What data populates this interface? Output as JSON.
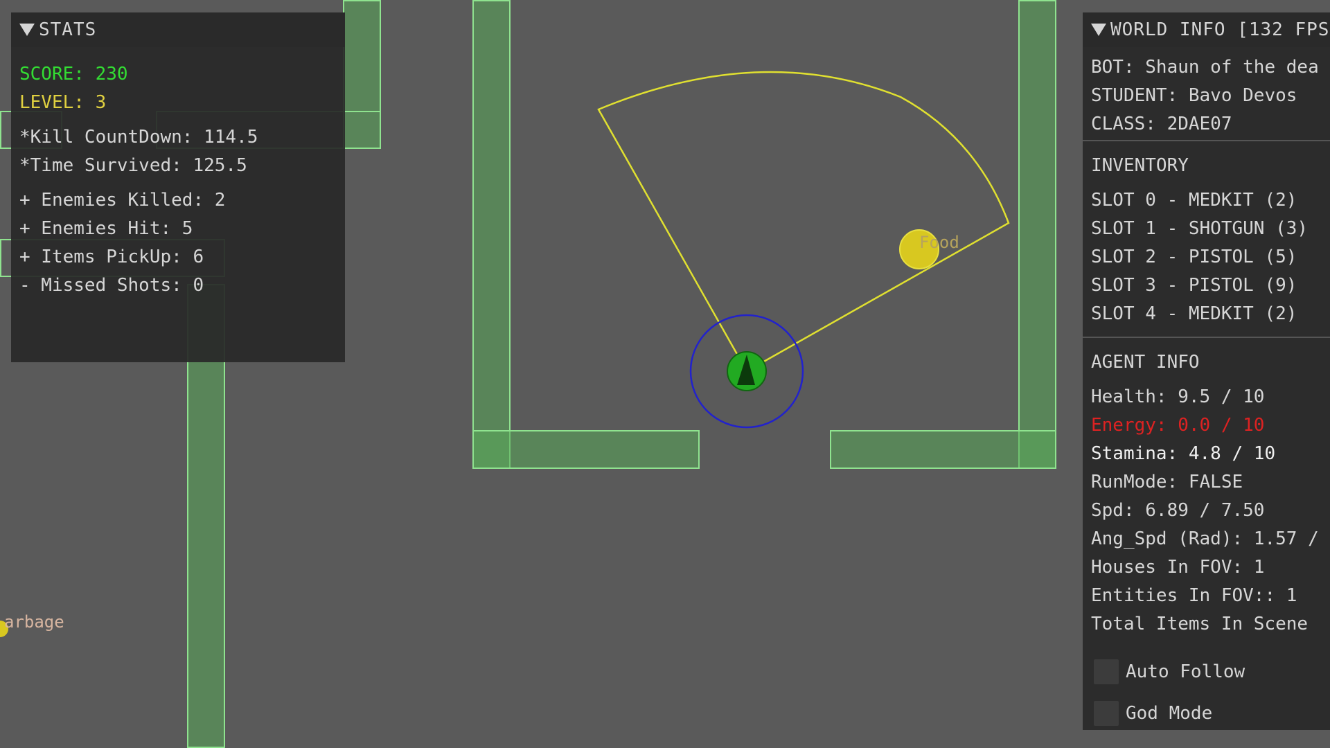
{
  "colors": {
    "background": "#5a5a5a",
    "panel": "#282828",
    "score": "#33dd33",
    "level": "#e0d040",
    "warning": "#dd2222",
    "fov": "#e0e030",
    "agent_ring": "#2222cc",
    "agent": "#22aa22",
    "wall": "#8fe38f",
    "item": "#d8c820"
  },
  "stats": {
    "header": "STATS",
    "score": "SCORE: 230",
    "level": "LEVEL: 3",
    "kill_countdown": "*Kill CountDown: 114.5",
    "time_survived": "*Time Survived: 125.5",
    "enemies_killed": "+ Enemies Killed: 2",
    "enemies_hit": "+ Enemies Hit: 5",
    "items_pickup": "+ Items PickUp: 6",
    "missed_shots": "- Missed Shots: 0"
  },
  "world": {
    "header": "WORLD INFO [132 FPS",
    "bot": "BOT: Shaun of the dea",
    "student": "STUDENT: Bavo Devos",
    "class": "CLASS: 2DAE07",
    "inventory_title": "INVENTORY",
    "slots": [
      "SLOT 0 - MEDKIT (2)",
      "SLOT 1 - SHOTGUN (3)",
      "SLOT 2 - PISTOL (5)",
      "SLOT 3 - PISTOL (9)",
      "SLOT 4 - MEDKIT (2)"
    ],
    "agent_title": "AGENT INFO",
    "health": "Health: 9.5 / 10",
    "energy": "Energy: 0.0 / 10",
    "stamina": "Stamina: 4.8 / 10",
    "runmode": "RunMode: FALSE",
    "speed": "Spd: 6.89 / 7.50",
    "ang_speed": "Ang_Spd (Rad): 1.57 /",
    "houses_fov": "Houses In FOV: 1",
    "entities_fov": "Entities In FOV:: 1",
    "total_items": "Total Items In Scene",
    "auto_follow": "Auto Follow",
    "god_mode": "God Mode"
  },
  "scene": {
    "food_label": "Food",
    "garbage_label": "arbage"
  }
}
